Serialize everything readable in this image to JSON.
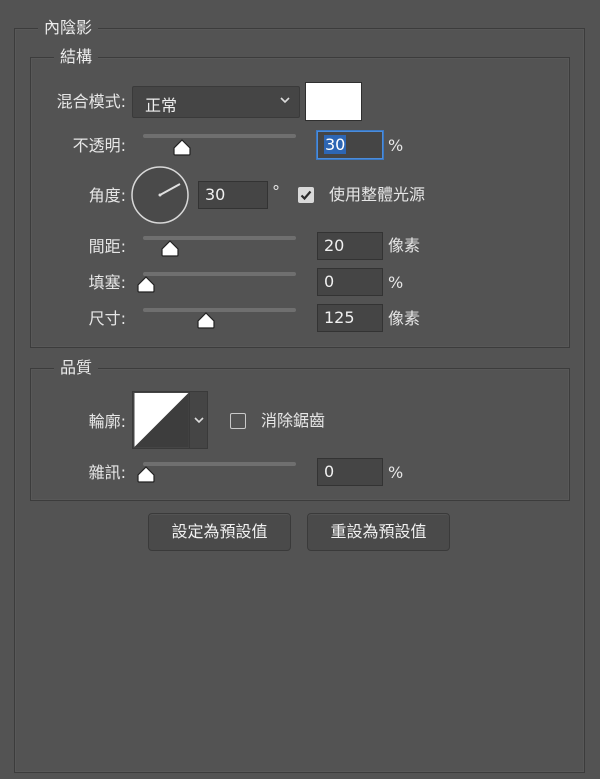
{
  "panel": {
    "title": "內陰影"
  },
  "structure": {
    "title": "結構",
    "blend_mode_label": "混合模式:",
    "blend_mode_value": "正常",
    "color_swatch": "#ffffff",
    "opacity_label": "不透明:",
    "opacity_value": "30",
    "opacity_unit": "%",
    "opacity_percent": 30,
    "angle_label": "角度:",
    "angle_value": "30",
    "angle_unit": "°",
    "global_light_label": "使用整體光源",
    "global_light_checked": true,
    "distance_label": "間距:",
    "distance_value": "20",
    "distance_unit": "像素",
    "distance_level": 0.2,
    "choke_label": "填塞:",
    "choke_value": "0",
    "choke_unit": "%",
    "choke_level": 0,
    "size_label": "尺寸:",
    "size_value": "125",
    "size_unit": "像素",
    "size_level": 0.5
  },
  "quality": {
    "title": "品質",
    "contour_label": "輪廓:",
    "anti_alias_label": "消除鋸齒",
    "anti_alias_checked": false,
    "noise_label": "雜訊:",
    "noise_value": "0",
    "noise_unit": "%",
    "noise_level": 0
  },
  "buttons": {
    "set_default": "設定為預設值",
    "reset_default": "重設為預設值"
  },
  "colors": {
    "background": "#535353",
    "field": "#454545",
    "focus": "#4b8cdb"
  },
  "icons": {
    "dropdown": "chevron-down-icon",
    "slider": "slider-thumb-icon",
    "angle": "angle-dial-icon",
    "check": "checkmark-icon"
  }
}
